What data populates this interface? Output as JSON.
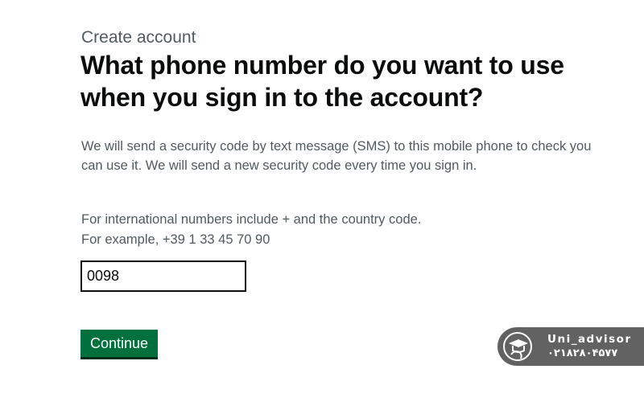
{
  "caption": "Create account",
  "heading": "What phone number do you want to use when you sign in to the account?",
  "body_text": "We will send a security code by text message (SMS) to this mobile phone to check you can use it. We will send a new security code every time you sign in.",
  "hint": {
    "line1": "For international numbers include + and the country code.",
    "line2": "For example, +39 1 33 45 70 90"
  },
  "phone_input": {
    "value": "0098"
  },
  "continue_label": "Continue",
  "watermark": {
    "name": "Uni_advisor",
    "phone": "۰۲۱۸۲۸۰۴۵۷۷",
    "logo_icon": "graduate-head-logo"
  },
  "colors": {
    "button_green": "#00703c",
    "button_shadow": "#002d18",
    "heading": "#0b0c0c",
    "secondary_text": "#505a5f",
    "watermark_bg": "#5a5a5a"
  }
}
